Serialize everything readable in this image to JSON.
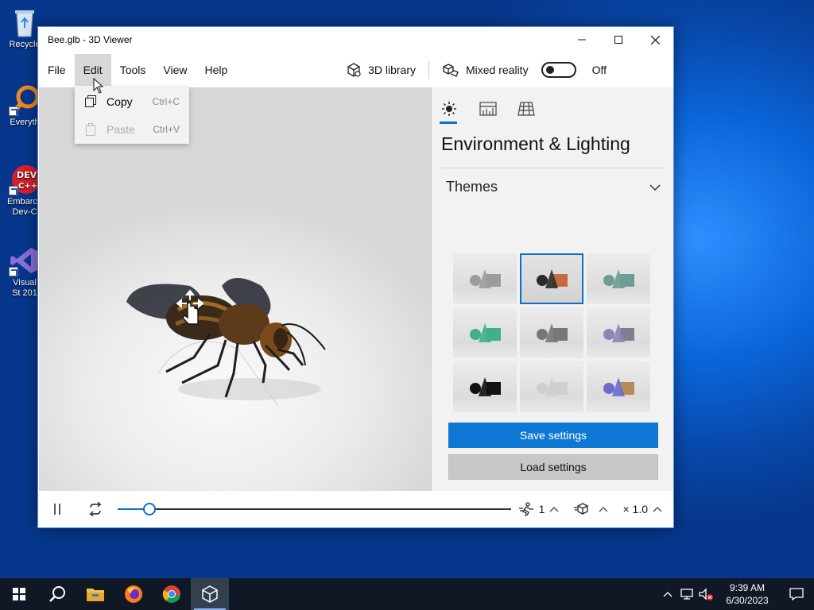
{
  "desktop": {
    "icons": [
      {
        "label": "Recycle",
        "name": "recycle-bin-icon"
      },
      {
        "label": "Everyth",
        "name": "everything-icon"
      },
      {
        "label": "Embarca Dev-C",
        "name": "devcpp-icon"
      },
      {
        "label": "Visual St 201",
        "name": "visual-studio-icon"
      }
    ]
  },
  "window": {
    "title": "Bee.glb - 3D Viewer",
    "controls": {
      "minimize": "minimize-icon",
      "maximize": "maximize-icon",
      "close": "close-icon"
    }
  },
  "menu": {
    "file": "File",
    "edit": "Edit",
    "tools": "Tools",
    "view": "View",
    "help": "Help"
  },
  "toolbar": {
    "library": "3D library",
    "mixed_reality": "Mixed reality",
    "mixed_reality_state": "Off"
  },
  "edit_menu": {
    "copy": {
      "label": "Copy",
      "shortcut": "Ctrl+C",
      "enabled": true
    },
    "paste": {
      "label": "Paste",
      "shortcut": "Ctrl+V",
      "enabled": false
    }
  },
  "panel": {
    "tabs": [
      {
        "name": "environment-lighting-tab",
        "icon": "sun-icon",
        "active": true
      },
      {
        "name": "stats-shading-tab",
        "icon": "stats-icon",
        "active": false
      },
      {
        "name": "grid-tab",
        "icon": "grid-icon",
        "active": false
      }
    ],
    "title": "Environment & Lighting",
    "themes_label": "Themes",
    "themes": [
      {
        "shape": "#9c9c9c",
        "selected": false
      },
      {
        "shape": "#c46a3c",
        "cone": "#2b2b2b",
        "selected": true
      },
      {
        "shape": "#6f9c94",
        "selected": false
      },
      {
        "shape": "#3fb08e",
        "selected": false
      },
      {
        "shape": "#777777",
        "selected": false
      },
      {
        "shape": "#7f7f8f",
        "cone": "#8a86b8",
        "selected": false
      },
      {
        "shape": "#111111",
        "selected": false
      },
      {
        "shape": "#cfcfcf",
        "selected": false
      },
      {
        "shape": "#b58c55",
        "cone": "#6e6ad0",
        "selected": false
      }
    ],
    "save_settings": "Save settings",
    "load_settings": "Load settings"
  },
  "playback": {
    "progress": 0.08,
    "speed_value": "1",
    "scale_value": "× 1.0"
  },
  "taskbar": {
    "apps": [
      "start-icon",
      "search-icon",
      "file-explorer-icon",
      "firefox-icon",
      "chrome-icon",
      "3d-viewer-icon"
    ],
    "time": "9:39 AM",
    "date": "6/30/2023"
  },
  "colors": {
    "accent": "#0f78d4",
    "desktop": "#0a63d6"
  }
}
